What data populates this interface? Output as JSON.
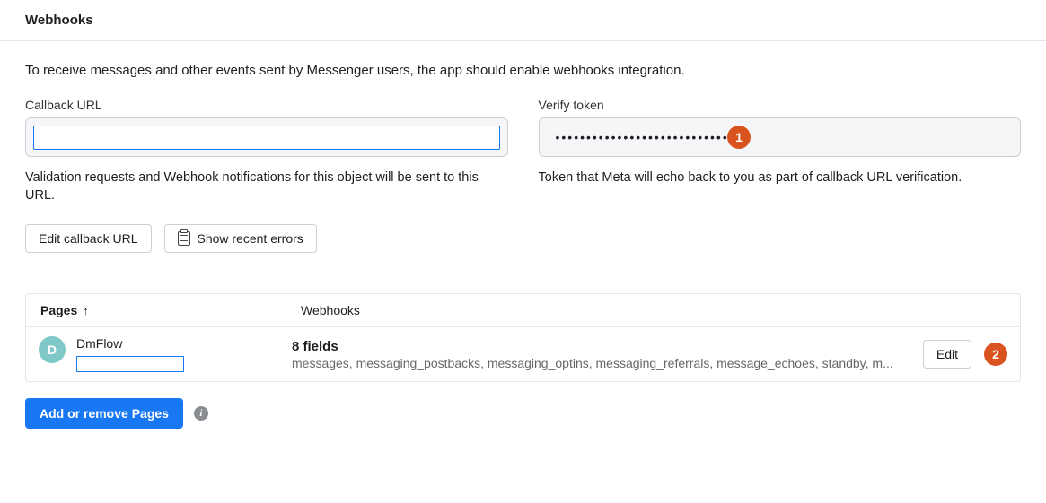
{
  "header": {
    "title": "Webhooks"
  },
  "config": {
    "intro": "To receive messages and other events sent by Messenger users, the app should enable webhooks integration.",
    "callback": {
      "label": "Callback URL",
      "value": "",
      "help": "Validation requests and Webhook notifications for this object will be sent to this URL."
    },
    "token": {
      "label": "Verify token",
      "masked": "••••••••••••••••••••••••••••",
      "help": "Token that Meta will echo back to you as part of callback URL verification."
    },
    "buttons": {
      "edit_callback": "Edit callback URL",
      "show_errors": "Show recent errors"
    }
  },
  "pages_table": {
    "columns": {
      "pages": "Pages",
      "webhooks": "Webhooks"
    },
    "sort_indicator": "↑",
    "rows": [
      {
        "avatar_letter": "D",
        "name": "DmFlow",
        "fields_count": "8 fields",
        "fields_list": "messages, messaging_postbacks, messaging_optins, messaging_referrals, message_echoes, standby, m...",
        "edit_label": "Edit"
      }
    ],
    "add_button": "Add or remove Pages"
  },
  "callouts": {
    "one": "1",
    "two": "2"
  },
  "icons": {
    "info_glyph": "i"
  }
}
